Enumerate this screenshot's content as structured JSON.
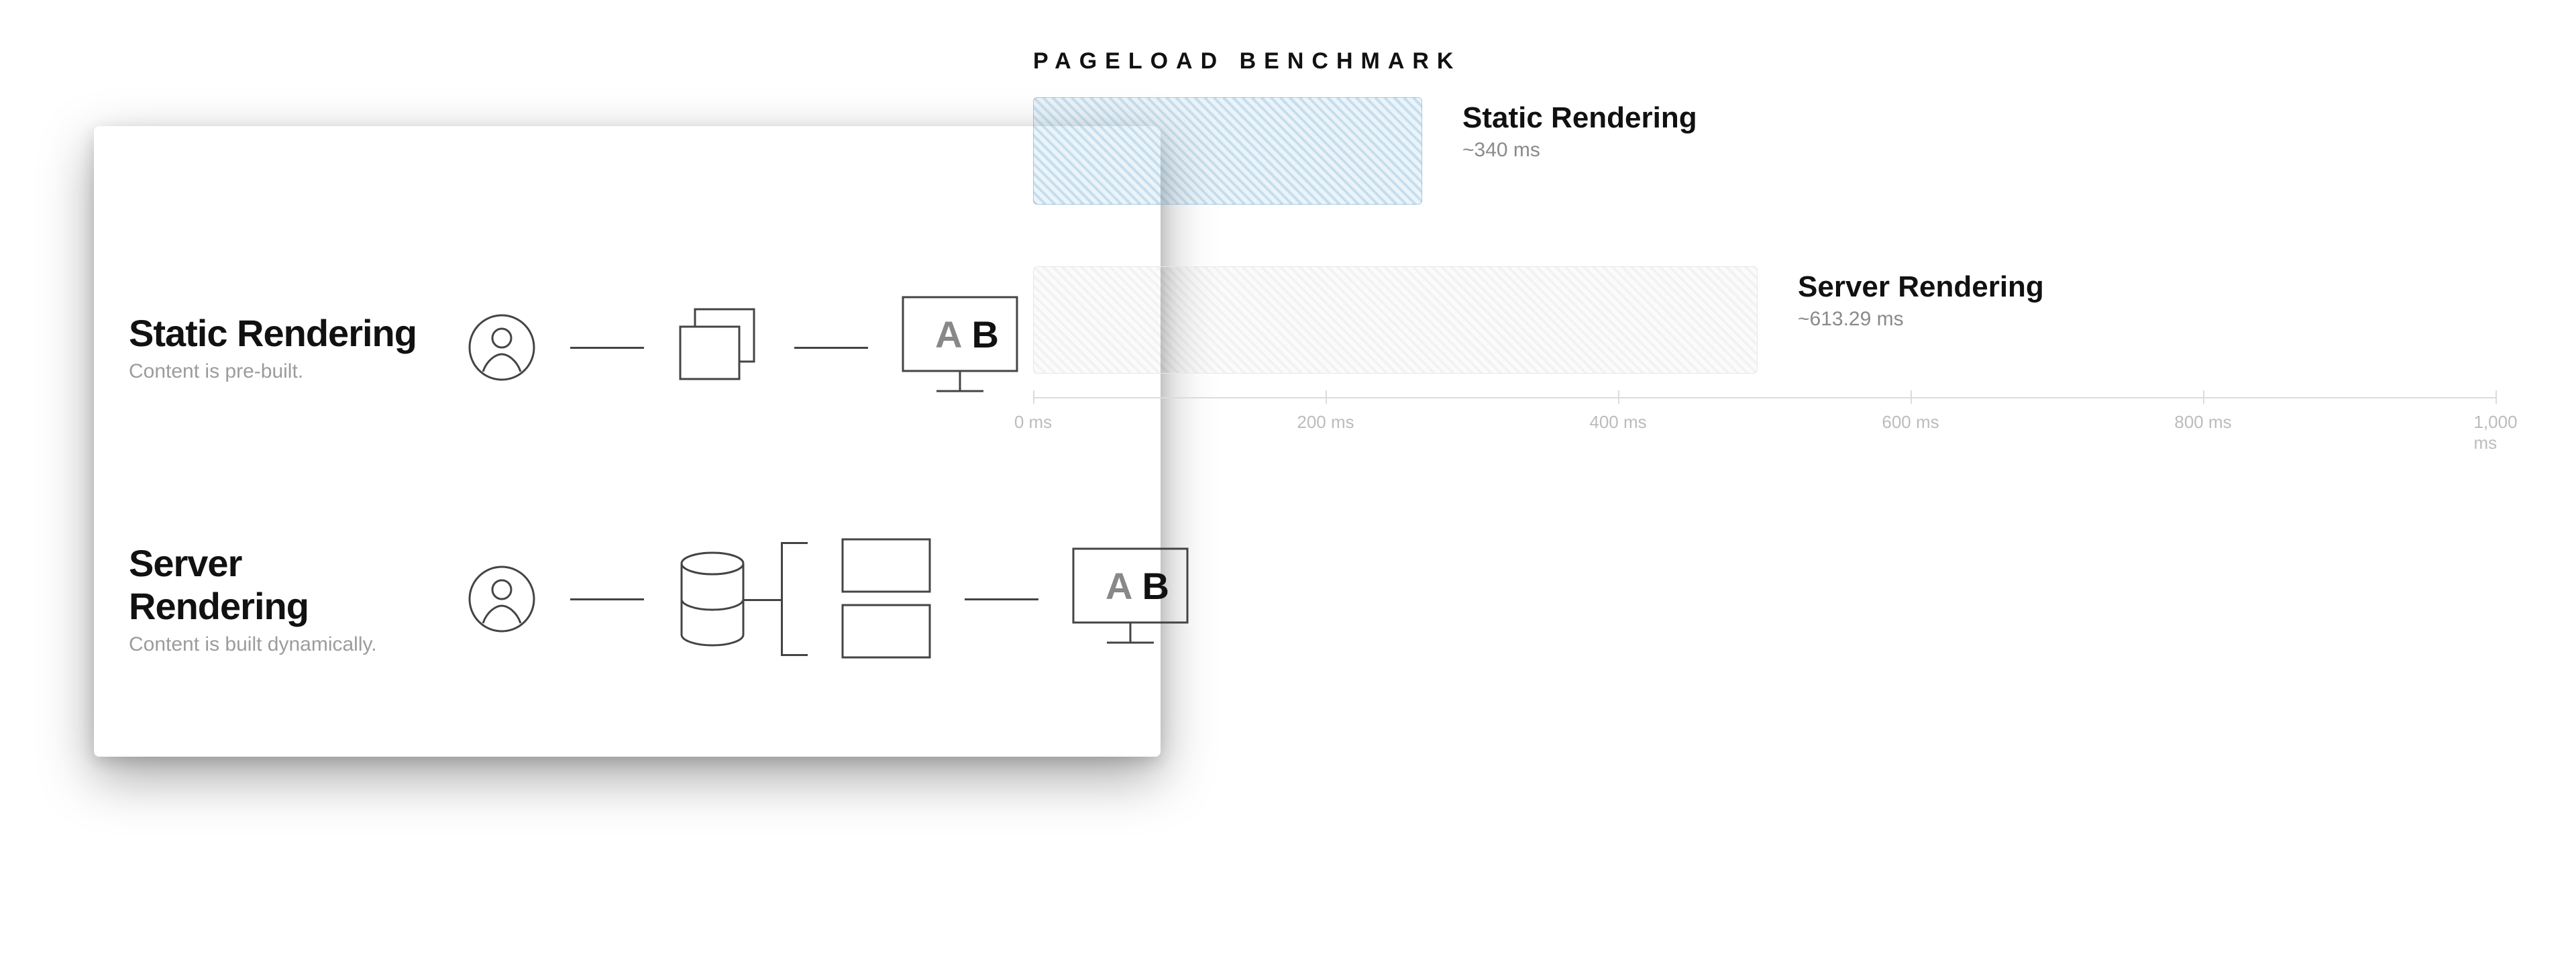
{
  "card": {
    "rows": [
      {
        "title": "Static Rendering",
        "sub": "Content is pre-built."
      },
      {
        "title": "Server Rendering",
        "sub": "Content is built dynamically."
      }
    ],
    "monitor_text": {
      "a": "A",
      "b": "B"
    }
  },
  "benchmark": {
    "title": "PAGELOAD BENCHMARK",
    "bars": [
      {
        "name": "Static Rendering",
        "value": "~340 ms"
      },
      {
        "name": "Server Rendering",
        "value": "~613.29 ms"
      }
    ],
    "axis": {
      "ticks": [
        {
          "pct": 0,
          "label": "0 ms"
        },
        {
          "pct": 20,
          "label": "200 ms"
        },
        {
          "pct": 40,
          "label": "400 ms"
        },
        {
          "pct": 60,
          "label": "600 ms"
        },
        {
          "pct": 80,
          "label": "800 ms"
        },
        {
          "pct": 100,
          "label": "1,000 ms"
        }
      ]
    }
  },
  "chart_data": {
    "type": "bar",
    "orientation": "horizontal",
    "title": "PAGELOAD BENCHMARK",
    "xlabel": "ms",
    "categories": [
      "Static Rendering",
      "Server Rendering"
    ],
    "values": [
      340,
      613.29
    ],
    "xlim": [
      0,
      1000
    ]
  }
}
